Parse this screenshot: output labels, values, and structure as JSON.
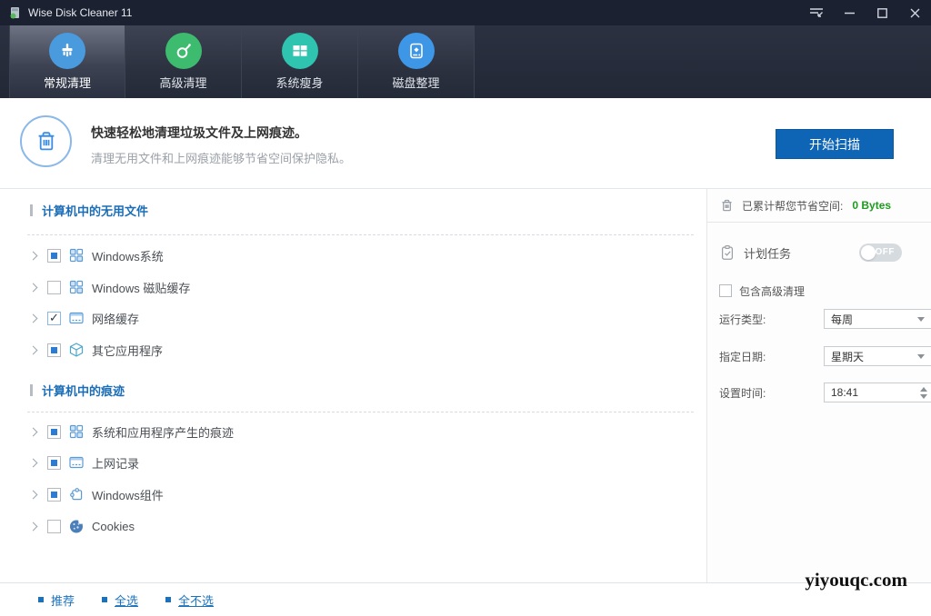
{
  "titlebar": {
    "title": "Wise Disk Cleaner 11",
    "icons": [
      "app-logo-icon",
      "menu-icon",
      "minimize-icon",
      "maximize-icon",
      "close-icon"
    ]
  },
  "tabs": [
    {
      "label": "常规清理",
      "active": true,
      "icon": "brush-icon"
    },
    {
      "label": "高级清理",
      "active": false,
      "icon": "magnifier-icon"
    },
    {
      "label": "系统瘦身",
      "active": false,
      "icon": "windows-flag-icon"
    },
    {
      "label": "磁盘整理",
      "active": false,
      "icon": "disk-icon"
    }
  ],
  "header": {
    "title": "快速轻松地清理垃圾文件及上网痕迹。",
    "subtitle": "清理无用文件和上网痕迹能够节省空间保护隐私。",
    "scan_button": "开始扫描"
  },
  "sections": [
    {
      "title": "计算机中的无用文件",
      "items": [
        {
          "label": "Windows系统",
          "state": "partial",
          "icon": "windows-grid-icon"
        },
        {
          "label": "Windows 磁贴缓存",
          "state": "unchecked",
          "icon": "windows-grid-icon"
        },
        {
          "label": "网络缓存",
          "state": "checked",
          "icon": "browser-window-icon"
        },
        {
          "label": "其它应用程序",
          "state": "partial",
          "icon": "cube-icon"
        }
      ]
    },
    {
      "title": "计算机中的痕迹",
      "items": [
        {
          "label": "系统和应用程序产生的痕迹",
          "state": "partial",
          "icon": "windows-grid-icon"
        },
        {
          "label": "上网记录",
          "state": "partial",
          "icon": "browser-window-icon"
        },
        {
          "label": "Windows组件",
          "state": "partial",
          "icon": "puzzle-icon"
        },
        {
          "label": "Cookies",
          "state": "unchecked",
          "icon": "cookie-icon"
        }
      ]
    }
  ],
  "side_panel": {
    "saved_space_label": "已累计帮您节省空间:",
    "saved_space_value": "0 Bytes",
    "scheduled_task_label": "计划任务",
    "toggle_state": "OFF",
    "include_advanced_label": "包含高级清理",
    "run_type_label": "运行类型:",
    "run_type_value": "每周",
    "day_label": "指定日期:",
    "day_value": "星期天",
    "time_label": "设置时间:",
    "time_value": "18:41"
  },
  "footer": {
    "links": [
      "推荐",
      "全选",
      "全不选"
    ]
  },
  "watermark": "yiyouqc.com",
  "colors": {
    "accent_blue": "#0e65b5",
    "link_blue": "#1b72bc",
    "value_green": "#1e9c1e",
    "titlebar_bg": "#1b2130",
    "tab_icon_1": "#4a9ade",
    "tab_icon_2": "#3dbb6e",
    "tab_icon_3": "#2ec4b0",
    "tab_icon_4": "#3e96e6"
  }
}
